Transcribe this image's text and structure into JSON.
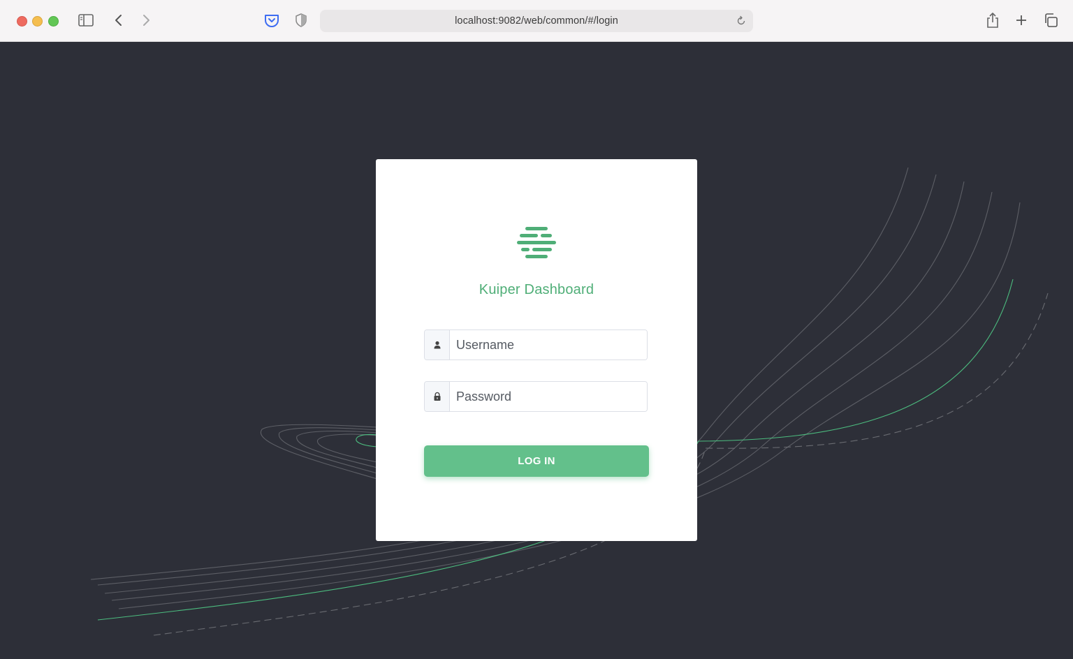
{
  "browser": {
    "url": "localhost:9082/web/common/#/login",
    "icons": [
      "sidebar-icon",
      "back-icon",
      "forward-icon",
      "pocket-icon",
      "shield-icon",
      "reload-icon",
      "share-icon",
      "new-tab-icon",
      "tabs-overview-icon"
    ]
  },
  "login": {
    "brand": "Kuiper Dashboard",
    "username_placeholder": "Username",
    "password_placeholder": "Password",
    "submit_label": "LOG IN"
  },
  "colors": {
    "accent": "#4fae77",
    "button": "#63c08b",
    "background": "#2d2f38"
  }
}
